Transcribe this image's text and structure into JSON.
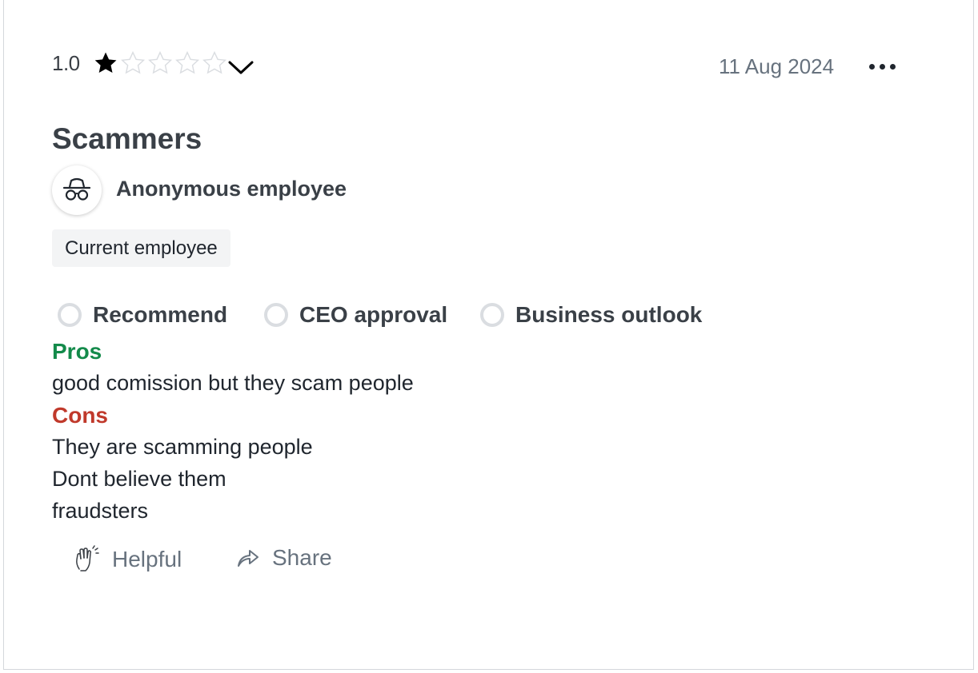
{
  "review": {
    "rating": "1.0",
    "rating_value": 1,
    "rating_max": 5,
    "date": "11 Aug 2024",
    "title": "Scammers",
    "author": "Anonymous employee",
    "employment_status": "Current employee",
    "indicators": [
      {
        "label": "Recommend",
        "icon": "empty-circle-icon"
      },
      {
        "label": "CEO approval",
        "icon": "empty-circle-icon"
      },
      {
        "label": "Business outlook",
        "icon": "empty-circle-icon"
      }
    ],
    "pros_heading": "Pros",
    "pros_text": "good comission but they scam people",
    "cons_heading": "Cons",
    "cons_lines": [
      "They are scamming people",
      "Dont believe them",
      "fraudsters"
    ],
    "actions": {
      "helpful_label": "Helpful",
      "helpful_icon": "high-five-icon",
      "share_label": "Share",
      "share_icon": "share-arrow-icon"
    }
  },
  "colors": {
    "pros": "#138a4a",
    "cons": "#c0392b",
    "muted": "#67727e",
    "star_filled": "#000000",
    "star_empty": "#dadde1"
  }
}
